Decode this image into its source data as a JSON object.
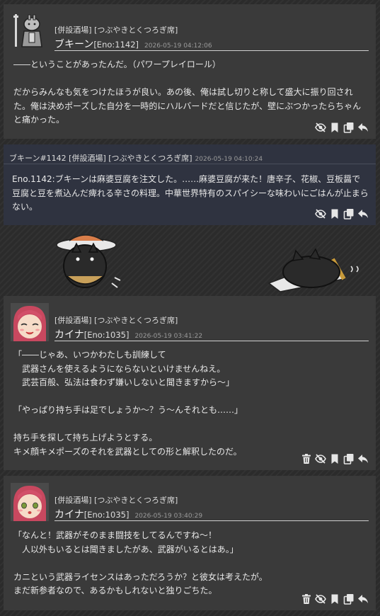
{
  "posts": [
    {
      "location": "[併設酒場] [つぶやきとくつろぎ席]",
      "name": "ブキーン",
      "eno": "[Eno:1142]",
      "timestamp": "2026-05-19 04:12:06",
      "body": "――ということがあったんだ。（パワープレイロール）\n\nだからみんなも気をつけたほうが良い。あの後、俺は試し切りと称して盛大に振り回された。俺は決めポーズした自分を一時的にハルバードだと信じたが、壁にぶつかったらちゃんと痛かった。"
    },
    {
      "head_name": "ブキーン#1142",
      "location": "[併設酒場] [つぶやきとくつろぎ席]",
      "timestamp": "2026-05-19 04:10:24",
      "body": "Eno.1142:ブキーンは麻婆豆腐を注文した。……麻婆豆腐が来た！唐辛子、花椒、豆板醤で豆腐と豆を煮込んだ痺れる辛さの料理。中華世界特有のスパイシーな味わいにごはんが止まらない。"
    },
    {
      "location": "[併設酒場] [つぶやきとくつろぎ席]",
      "name": "カイナ",
      "eno": "[Eno:1035]",
      "timestamp": "2026-05-19 03:41:22",
      "body": "「――じゃあ、いつかわたしも訓練して\n　武器さんを使えるようにならないといけませんねえ。\n　武芸百般、弘法は食わず嫌いしないと聞きますから～」\n\n「やっぱり持ち手は足でしょうか～？う～んそれとも……」\n\n持ち手を探して持ち上げようとする。\nキメ顔キメポーズのそれを武器としての形と解釈したのだ。"
    },
    {
      "location": "[併設酒場] [つぶやきとくつろぎ席]",
      "name": "カイナ",
      "eno": "[Eno:1035]",
      "timestamp": "2026-05-19 03:40:29",
      "body": "「なんと！武器がそのまま闘技をしてるんですね～！\n　人以外もいるとは聞きましたがあ、武器がいるとはあ。」\n\nカニという武器ライセンスはあっただろうか？と彼女は考えたが。\nまだ新参者なので、あるかもしれないと独りごちた。"
    }
  ],
  "icons": {
    "delete": "trash-icon",
    "hide": "eye-slash-icon",
    "bookmark": "bookmark-icon",
    "copy": "copy-icon",
    "reply": "reply-icon"
  },
  "colors": {
    "post_bg": "#3a3a3a",
    "speech_bg": "#2f3340",
    "page_bg": "#2b2b2b"
  }
}
